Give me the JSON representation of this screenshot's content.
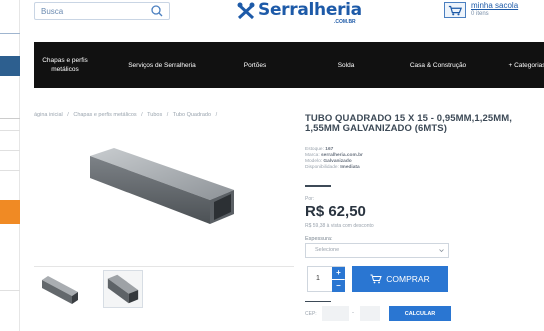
{
  "header": {
    "search_placeholder": "Busca",
    "logo_text": "Serralheria",
    "logo_sub": ".COM.BR",
    "cart_title": "minha sacola",
    "cart_count": "0 itens"
  },
  "nav": {
    "items": [
      {
        "label": "Chapas e perfis metálicos"
      },
      {
        "label": "Serviços de Serralheria"
      },
      {
        "label": "Portões"
      },
      {
        "label": "Solda"
      },
      {
        "label": "Casa & Construção"
      },
      {
        "label": "+ Categorias"
      }
    ]
  },
  "breadcrumb": [
    "ágina inicial",
    "/",
    "Chapas e perfis metálicos",
    "/",
    "Tubos",
    "/",
    "Tubo Quadrado",
    "/"
  ],
  "product": {
    "title": "TUBO QUADRADO 15 X 15 - 0,95MM,1,25MM, 1,55MM GALVANIZADO (6MTS)",
    "estoque_label": "Estoque:",
    "estoque_value": "167",
    "marca_label": "Marca:",
    "marca_value": "serralheria.com.br",
    "modelo_label": "Modelo:",
    "modelo_value": "Galvanizado",
    "disponibilidade_label": "Disponibilidade:",
    "disponibilidade_value": "Imediata",
    "por_label": "Por:",
    "price": "R$ 62,50",
    "price_sub": "R$ 59,38 à vista com desconto",
    "espessura_label": "Espessura:",
    "select_placeholder": "Selecione",
    "quantity": "1",
    "buy_label": "COMPRAR",
    "cep_label": "CEP:",
    "cep_dash": "-",
    "calc_label": "CALCULAR"
  },
  "colors": {
    "brand_blue": "#1d5aa8",
    "button_blue": "#2a76d2",
    "nav_bg": "#111111"
  }
}
